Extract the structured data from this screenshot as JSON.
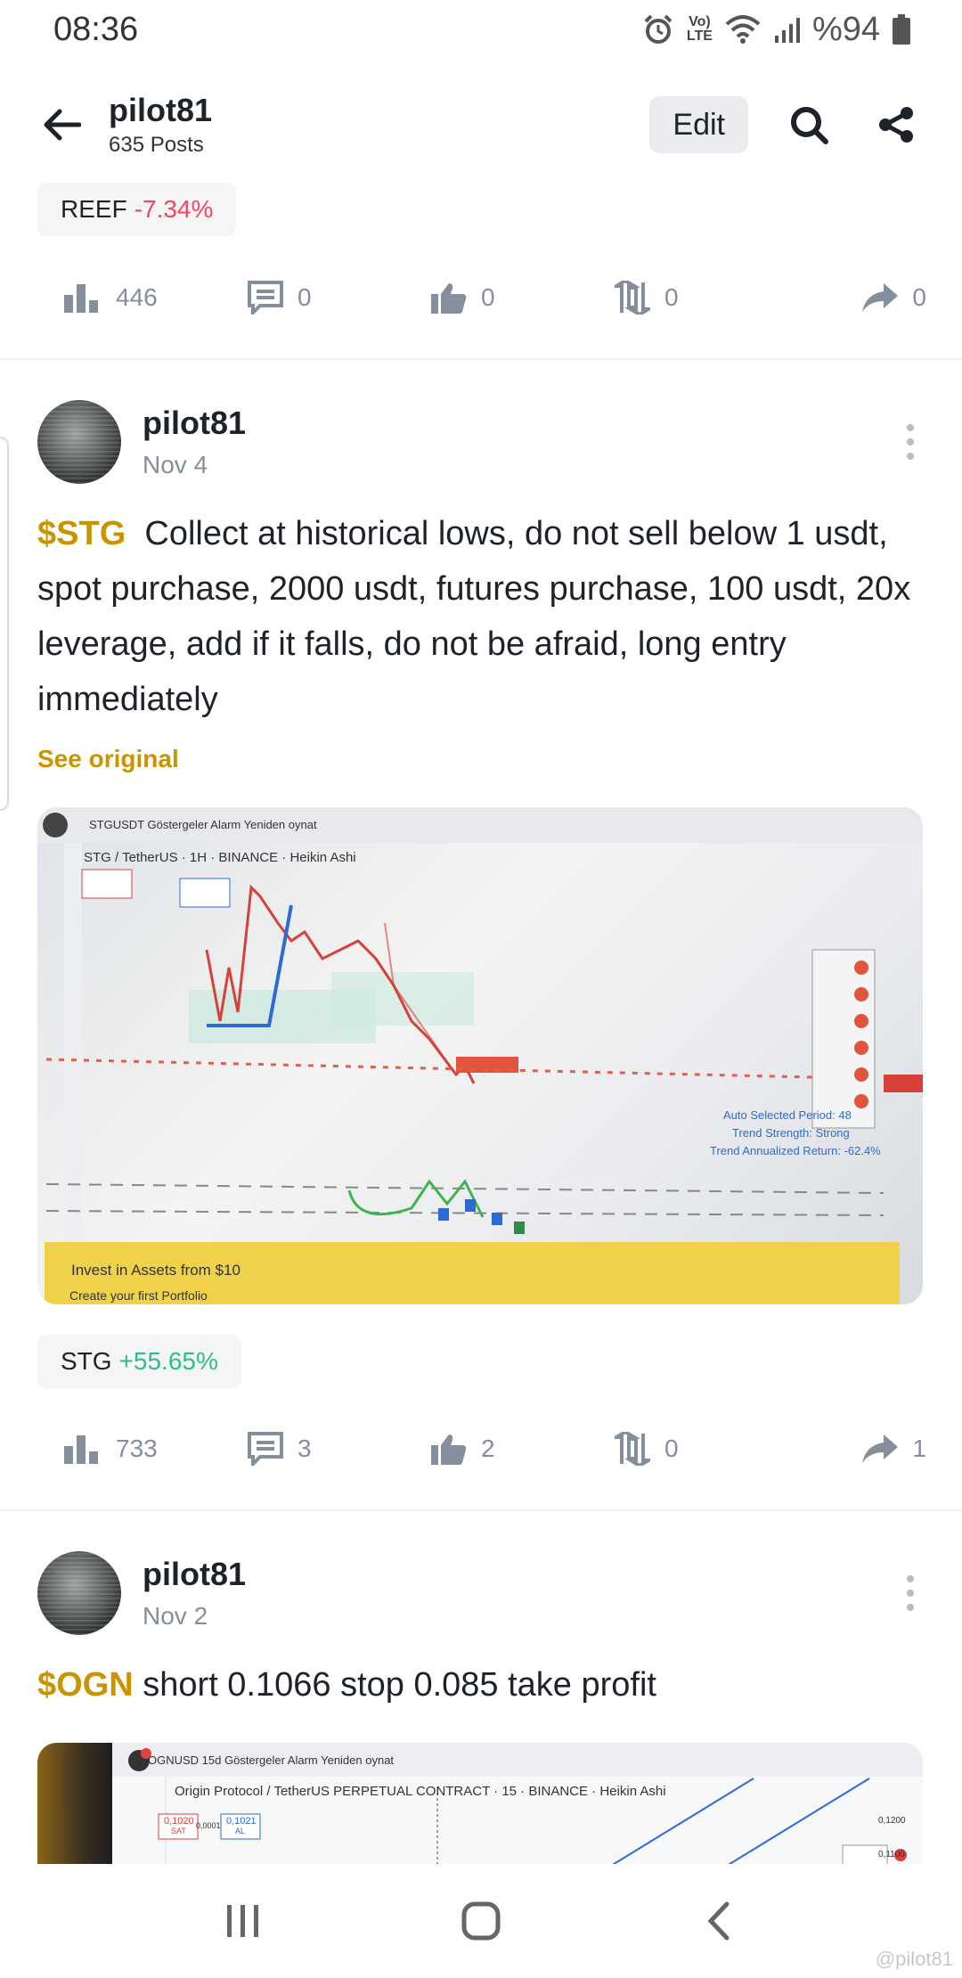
{
  "status_bar": {
    "time": "08:36",
    "battery": "%94",
    "network": "Vo) LTE"
  },
  "header": {
    "name": "pilot81",
    "posts_count": "635 Posts",
    "edit_label": "Edit"
  },
  "top_tag": {
    "symbol": "REEF",
    "change": "-7.34%"
  },
  "top_actions": {
    "views": "446",
    "comments": "0",
    "likes": "0",
    "reposts": "0",
    "shares": "0"
  },
  "post1": {
    "author": "pilot81",
    "date": "Nov 4",
    "cashtag": "$STG",
    "text": "Collect at historical lows, do not sell below 1 usdt, spot purchase, 2000 usdt, futures purchase, 100 usdt, 20x leverage, add if it falls, do not be afraid, long entry immediately",
    "see_original": "See original",
    "image": {
      "chart_title": "STG / TetherUS · 1H · BINANCE · Heikin Ashi",
      "toolbar": "STGUSDT   Göstergeler   Alarm   Yeniden oynat",
      "promo_line1": "Invest in Assets from $10",
      "promo_line2": "Create your first Portfolio",
      "side_text1": "Auto Selected Period: 48",
      "side_text2": "Trend Strength: Strong",
      "side_text3": "Trend Annualized Return: -62.4%"
    },
    "tag": {
      "symbol": "STG",
      "change": "+55.65%"
    },
    "actions": {
      "views": "733",
      "comments": "3",
      "likes": "2",
      "reposts": "0",
      "shares": "1"
    }
  },
  "post2": {
    "author": "pilot81",
    "date": "Nov 2",
    "cashtag": "$OGN",
    "text": "short 0.1066 stop 0.085 take profit",
    "image": {
      "toolbar": "OGNUSD   15d   Göstergeler   Alarm   Yeniden oynat",
      "chart_title": "Origin Protocol / TetherUS PERPETUAL CONTRACT · 15 · BINANCE · Heikin Ashi",
      "sell_price": "0,1020",
      "spread": "0,0001",
      "buy_price": "0,1021",
      "sell_label": "SAT",
      "buy_label": "AL",
      "axis_top": "0,1200",
      "axis_bottom": "0,1100"
    }
  },
  "watermark": "@pilot81",
  "colors": {
    "accent": "#c99400",
    "negative": "#f6465d",
    "positive": "#2ebd85",
    "muted": "#848e9c"
  }
}
